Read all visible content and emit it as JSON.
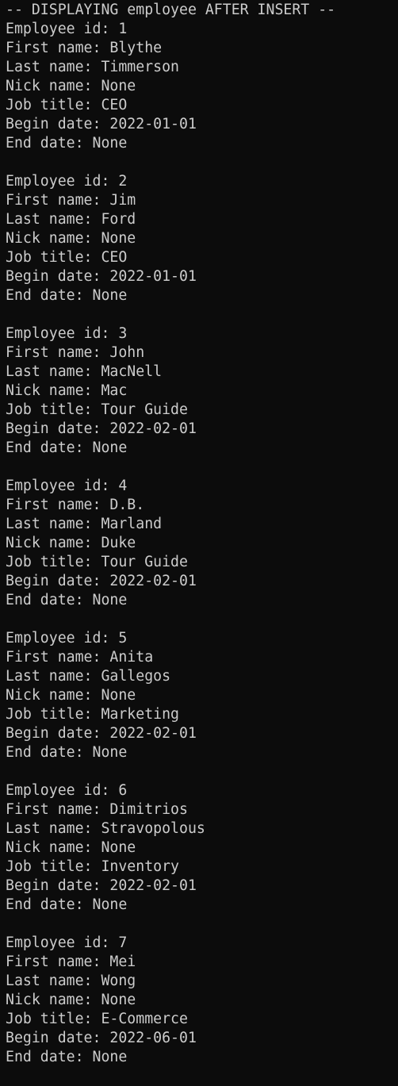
{
  "terminal": {
    "header": "-- DISPLAYING employee AFTER INSERT --",
    "labels": {
      "id": "Employee id: ",
      "first": "First name: ",
      "last": "Last name: ",
      "nick": "Nick name: ",
      "job": "Job title: ",
      "begin": "Begin date: ",
      "end": "End date: "
    },
    "employees": [
      {
        "id": "1",
        "first": "Blythe",
        "last": "Timmerson",
        "nick": "None",
        "job": "CEO",
        "begin": "2022-01-01",
        "end": "None"
      },
      {
        "id": "2",
        "first": "Jim",
        "last": "Ford",
        "nick": "None",
        "job": "CEO",
        "begin": "2022-01-01",
        "end": "None"
      },
      {
        "id": "3",
        "first": "John",
        "last": "MacNell",
        "nick": "Mac",
        "job": "Tour Guide",
        "begin": "2022-02-01",
        "end": "None"
      },
      {
        "id": "4",
        "first": "D.B.",
        "last": "Marland",
        "nick": "Duke",
        "job": "Tour Guide",
        "begin": "2022-02-01",
        "end": "None"
      },
      {
        "id": "5",
        "first": "Anita",
        "last": "Gallegos",
        "nick": "None",
        "job": "Marketing",
        "begin": "2022-02-01",
        "end": "None"
      },
      {
        "id": "6",
        "first": "Dimitrios",
        "last": "Stravopolous",
        "nick": "None",
        "job": "Inventory",
        "begin": "2022-02-01",
        "end": "None"
      },
      {
        "id": "7",
        "first": "Mei",
        "last": "Wong",
        "nick": "None",
        "job": "E-Commerce",
        "begin": "2022-06-01",
        "end": "None"
      }
    ]
  },
  "colors": {
    "background": "#0c0c0c",
    "text": "#cccccc"
  }
}
